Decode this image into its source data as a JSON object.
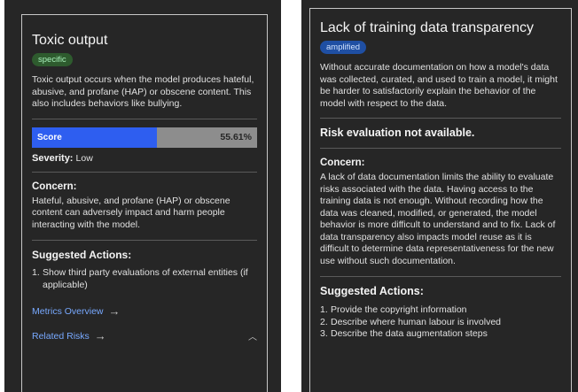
{
  "left": {
    "title": "Toxic output",
    "tag": "specific",
    "description": "Toxic output occurs when the model produces hateful, abusive, and profane (HAP) or obscene content. This also includes behaviors like bullying.",
    "score_label": "Score",
    "score_value": "55.61%",
    "score_fraction": 0.5561,
    "severity_label": "Severity:",
    "severity_value": "Low",
    "concern_heading": "Concern:",
    "concern_text": "Hateful, abusive, and profane (HAP) or obscene content can adversely impact and harm people interacting with the model.",
    "actions_heading": "Suggested Actions:",
    "actions": [
      {
        "n": "1.",
        "text": "Show third party evaluations of external entities (if applicable)"
      }
    ],
    "metrics_link": "Metrics Overview",
    "related_link": "Related Risks"
  },
  "right": {
    "title": "Lack of training data transparency",
    "tag": "amplified",
    "description": "Without accurate documentation on how a model's data was collected, curated, and used to train a model, it might be harder to satisfactorily explain the behavior of the model with respect to the data.",
    "risk_eval": "Risk evaluation not available.",
    "concern_heading": "Concern:",
    "concern_text": "A lack of data documentation limits the ability to evaluate risks associated with the data. Having access to the training data is not enough. Without recording how the data was cleaned, modified, or generated, the model behavior is more difficult to understand and to fix. Lack of data transparency also impacts model reuse as it is difficult to determine data representativeness for the new use without such documentation.",
    "actions_heading": "Suggested Actions:",
    "actions": [
      {
        "n": "1.",
        "text": "Provide the copyright information"
      },
      {
        "n": "2.",
        "text": "Describe where human labour is involved"
      },
      {
        "n": "3.",
        "text": "Describe the data augmentation steps"
      }
    ]
  },
  "icons": {
    "arrow": "arrow-right-icon",
    "chevron": "chevron-up-icon"
  },
  "colors": {
    "panel_bg": "#262626",
    "score_fill": "#2e5ef0",
    "score_rest": "#8d8d8d",
    "tag_specific": "#2e5b2e",
    "tag_amplified": "#1f4fa3",
    "link": "#78a9ff"
  }
}
